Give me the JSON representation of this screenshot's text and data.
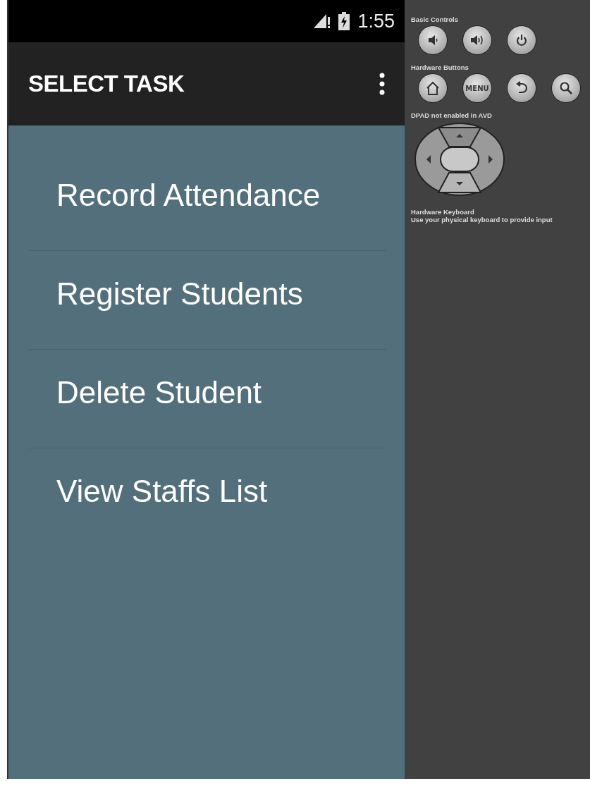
{
  "status_bar": {
    "time": "1:55"
  },
  "app_bar": {
    "title": "SELECT TASK"
  },
  "tasks": [
    {
      "label": "Record Attendance"
    },
    {
      "label": "Register Students"
    },
    {
      "label": "Delete Student"
    },
    {
      "label": "View Staffs List"
    }
  ],
  "controls_panel": {
    "sections": [
      {
        "kind": "buttons",
        "title": "Basic Controls",
        "buttons": [
          {
            "kind": "volume-down"
          },
          {
            "kind": "volume-up"
          },
          {
            "kind": "power"
          }
        ]
      },
      {
        "kind": "buttons",
        "title": "Hardware Buttons",
        "buttons": [
          {
            "kind": "home"
          },
          {
            "kind": "menu",
            "label": "MENU"
          },
          {
            "kind": "back"
          },
          {
            "kind": "search"
          }
        ]
      },
      {
        "kind": "dpad",
        "title": "DPAD not enabled in AVD"
      },
      {
        "kind": "note",
        "title": "Hardware Keyboard",
        "text": "Use your physical keyboard to provide input"
      }
    ]
  }
}
